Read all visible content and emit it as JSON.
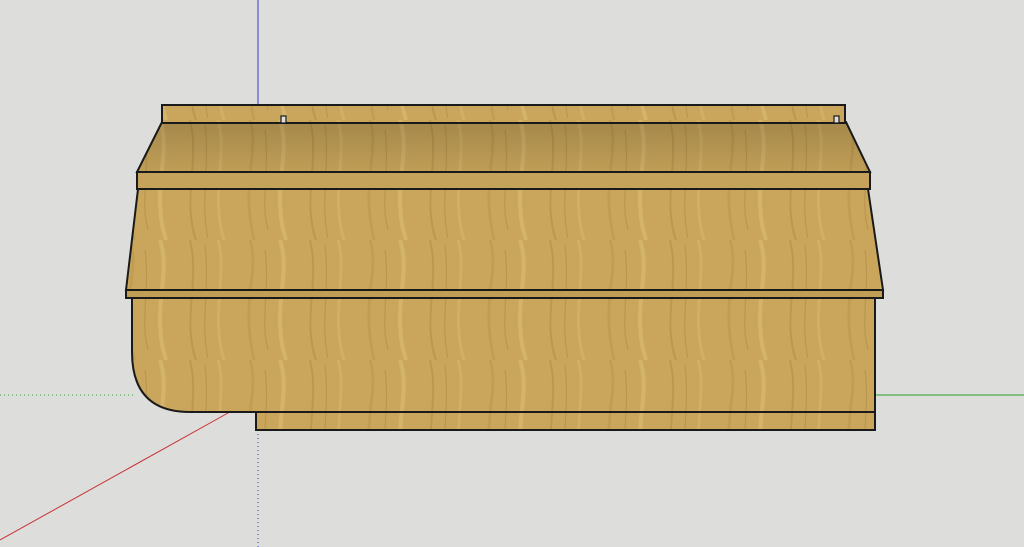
{
  "viewport": {
    "background": "#dddddc",
    "description_icon": "3d-model-viewport"
  },
  "axes": {
    "blue": "#3b3bd1",
    "red": "#c83232",
    "green": "#2a9d2a"
  },
  "model": {
    "wood_base": "#c8a55a",
    "wood_light": "#d6b46a",
    "wood_dark": "#a8843f",
    "outline": "#1a1a1a"
  }
}
